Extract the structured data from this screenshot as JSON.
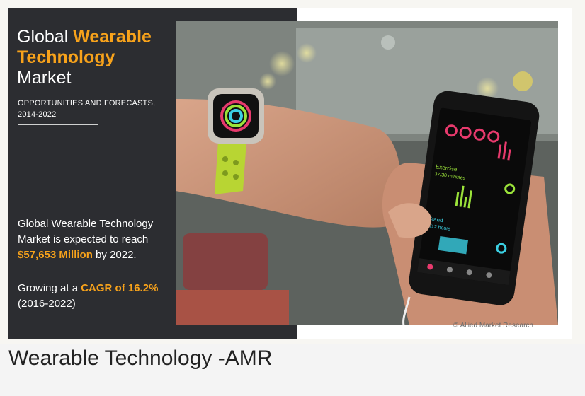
{
  "title": {
    "line1_plain": "Global ",
    "line1_accent": "Wearable",
    "line2_accent": "Technology",
    "line3_plain": "Market"
  },
  "subtitle": {
    "line1": "OPPORTUNITIES AND FORECASTS,",
    "line2": "2014-2022"
  },
  "stat_market": {
    "line1": "Global Wearable Technology",
    "line2": "Market is expected to reach",
    "value": "$57,653 Million",
    "suffix": " by 2022."
  },
  "stat_cagr": {
    "prefix": "Growing at a ",
    "value": "CAGR of 16.2%",
    "period": "(2016-2022)"
  },
  "photo": {
    "phone_exercise_label": "Exercise",
    "phone_exercise_value": "37/30 minutes",
    "phone_stand_label": "Stand",
    "phone_stand_value": "6/12 hours"
  },
  "credit": "© Allied Market Research",
  "caption": "Wearable Technology -AMR",
  "colors": {
    "accent": "#f7a21b",
    "panel": "#2c2d31"
  }
}
